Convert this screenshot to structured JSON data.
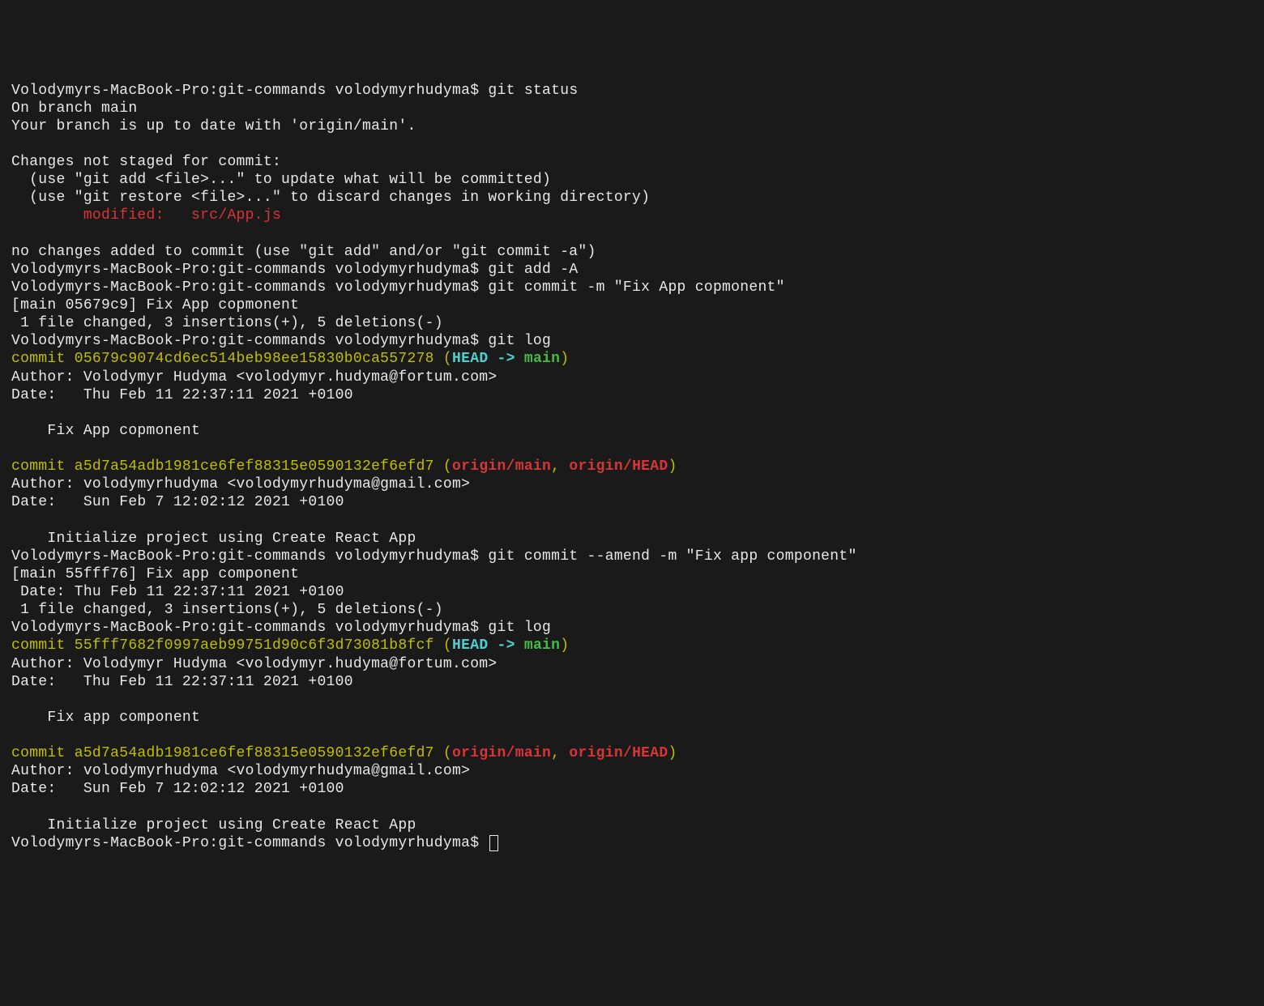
{
  "prompt": "Volodymyrs-MacBook-Pro:git-commands volodymyrhudyma$ ",
  "cmd": {
    "status": "git status",
    "addA": "git add -A",
    "commit1": "git commit -m \"Fix App copmonent\"",
    "log1": "git log",
    "amend": "git commit --amend -m \"Fix app component\"",
    "log2": "git log"
  },
  "status": {
    "branch": "On branch main",
    "upToDate": "Your branch is up to date with 'origin/main'.",
    "notStaged": "Changes not staged for commit:",
    "hint1": "  (use \"git add <file>...\" to update what will be committed)",
    "hint2": "  (use \"git restore <file>...\" to discard changes in working directory)",
    "modified": "        modified:   src/App.js",
    "noChanges": "no changes added to commit (use \"git add\" and/or \"git commit -a\")"
  },
  "commit1": {
    "summary": "[main 05679c9] Fix App copmonent",
    "stats": " 1 file changed, 3 insertions(+), 5 deletions(-)"
  },
  "log1": {
    "c1_prefix": "commit 05679c9074cd6ec514beb98ee15830b0ca557278",
    "lparen": " (",
    "head": "HEAD -> ",
    "main": "main",
    "rparen": ")",
    "author1": "Author: Volodymyr Hudyma <volodymyr.hudyma@fortum.com>",
    "date1": "Date:   Thu Feb 11 22:37:11 2021 +0100",
    "msg1": "    Fix App copmonent",
    "c2_prefix": "commit a5d7a54adb1981ce6fef88315e0590132ef6efd7",
    "origin_main": "origin/main",
    "comma": ", ",
    "origin_head": "origin/HEAD",
    "author2": "Author: volodymyrhudyma <volodymyrhudyma@gmail.com>",
    "date2": "Date:   Sun Feb 7 12:02:12 2021 +0100",
    "msg2": "    Initialize project using Create React App"
  },
  "amendOut": {
    "summary": "[main 55fff76] Fix app component",
    "date": " Date: Thu Feb 11 22:37:11 2021 +0100",
    "stats": " 1 file changed, 3 insertions(+), 5 deletions(-)"
  },
  "log2": {
    "c1_prefix": "commit 55fff7682f0997aeb99751d90c6f3d73081b8fcf",
    "author1": "Author: Volodymyr Hudyma <volodymyr.hudyma@fortum.com>",
    "date1": "Date:   Thu Feb 11 22:37:11 2021 +0100",
    "msg1": "    Fix app component",
    "c2_prefix": "commit a5d7a54adb1981ce6fef88315e0590132ef6efd7",
    "author2": "Author: volodymyrhudyma <volodymyrhudyma@gmail.com>",
    "date2": "Date:   Sun Feb 7 12:02:12 2021 +0100",
    "msg2": "    Initialize project using Create React App"
  }
}
